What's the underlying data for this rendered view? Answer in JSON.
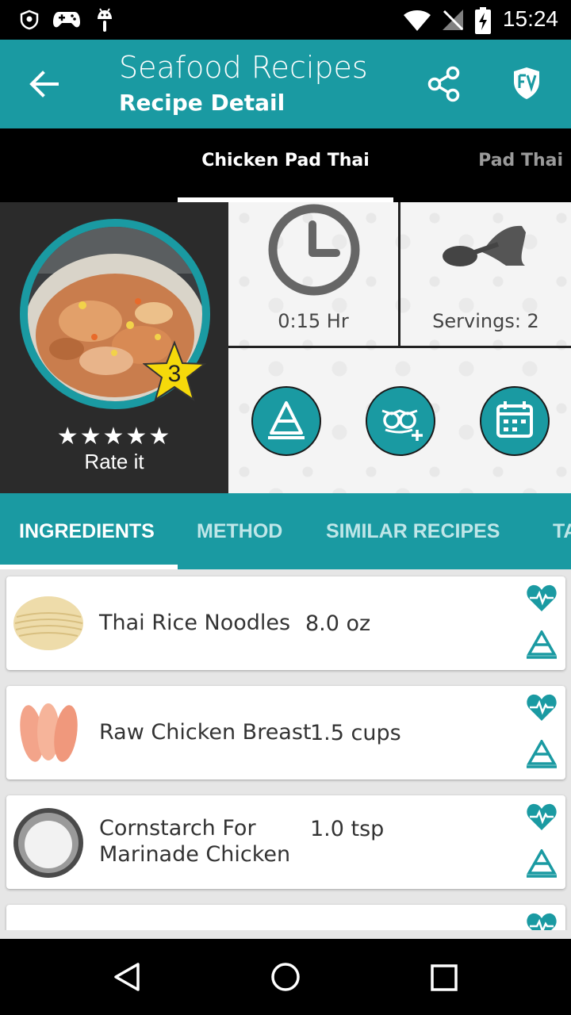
{
  "status_bar": {
    "time": "15:24"
  },
  "app_bar": {
    "title": "Seafood Recipes",
    "subtitle": "Recipe Detail"
  },
  "recipe_tabs": [
    {
      "label": "Chicken Pad Thai"
    },
    {
      "label": "Pad Thai"
    }
  ],
  "recipe": {
    "rating_badge": "3",
    "rate_label": "Rate it",
    "stars": "★★★★★",
    "time": "0:15 Hr",
    "servings": "Servings: 2"
  },
  "main_tabs": [
    {
      "label": "INGREDIENTS"
    },
    {
      "label": "METHOD"
    },
    {
      "label": "SIMILAR RECIPES"
    },
    {
      "label": "TA"
    }
  ],
  "ingredients": [
    {
      "name": "Thai Rice Noodles",
      "qty": "8.0 oz",
      "thumb": "noodles"
    },
    {
      "name": "Raw Chicken Breast",
      "qty": "1.5 cups",
      "thumb": "chicken"
    },
    {
      "name": "Cornstarch For Marinade Chicken",
      "qty": "1.0 tsp",
      "thumb": "cornstarch"
    }
  ],
  "colors": {
    "teal": "#1a9aa2",
    "dark_panel": "#2b2b2b",
    "star_yellow": "#f5d90a"
  }
}
